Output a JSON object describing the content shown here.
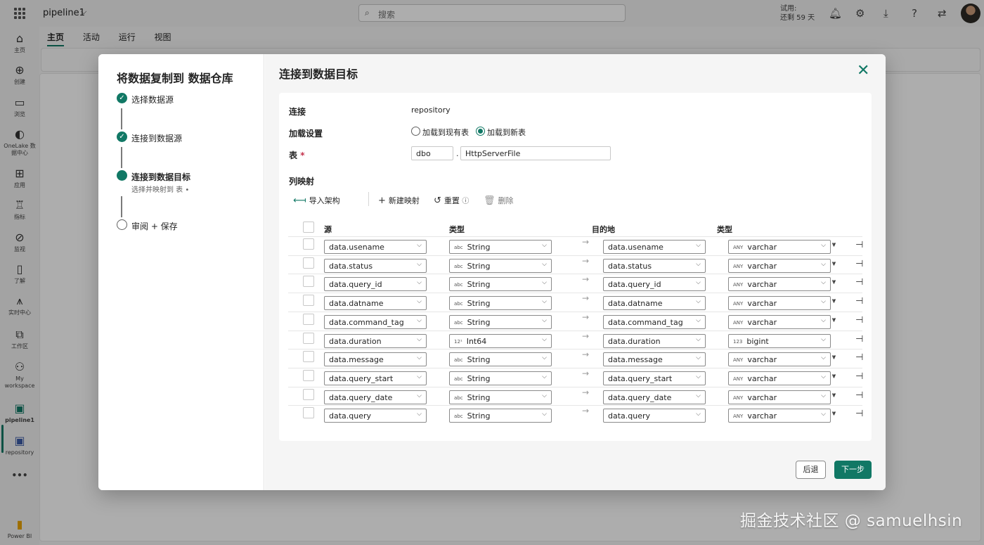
{
  "topbar": {
    "app_title": "pipeline1",
    "search_placeholder": "搜索",
    "trial_line1": "试用:",
    "trial_line2": "还剩 59 天"
  },
  "rail": {
    "items": [
      {
        "label": "主页",
        "icon": "home-icon"
      },
      {
        "label": "创建",
        "icon": "create-icon"
      },
      {
        "label": "浏览",
        "icon": "folder-icon"
      },
      {
        "label": "OneLake 数据中心",
        "icon": "onelake-icon"
      },
      {
        "label": "应用",
        "icon": "apps-icon"
      },
      {
        "label": "指标",
        "icon": "trophy-icon"
      },
      {
        "label": "监视",
        "icon": "monitor-icon"
      },
      {
        "label": "了解",
        "icon": "book-icon"
      },
      {
        "label": "实时中心",
        "icon": "realtime-icon"
      },
      {
        "label": "工作区",
        "icon": "workspace-icon"
      },
      {
        "label": "My workspace",
        "icon": "my-workspace-icon"
      },
      {
        "label": "pipeline1",
        "icon": "pipeline-icon"
      },
      {
        "label": "repository",
        "icon": "repository-icon"
      }
    ],
    "more": "•••",
    "powerbi": "Power BI"
  },
  "ribbon": {
    "tabs": [
      "主页",
      "活动",
      "运行",
      "视图"
    ]
  },
  "wizard": {
    "title": "将数据复制到 数据仓库",
    "steps": [
      {
        "label": "选择数据源",
        "state": "done"
      },
      {
        "label": "连接到数据源",
        "state": "done"
      },
      {
        "label": "连接到数据目标",
        "state": "current",
        "sub": "选择并映射到 表 •"
      },
      {
        "label": "审阅 + 保存",
        "state": "todo"
      }
    ]
  },
  "dest": {
    "title": "连接到数据目标",
    "connection_label": "连接",
    "connection_value": "repository",
    "load_label": "加载设置",
    "load_existing": "加载到现有表",
    "load_new": "加载到新表",
    "table_label": "表",
    "table_required": "*",
    "schema_value": "dbo",
    "dot": ".",
    "table_value": "HttpServerFile",
    "mapping_title": "列映射",
    "import_schema": "导入架构",
    "new_mapping": "新建映射",
    "reset": "重置",
    "delete": "删除",
    "col_source": "源",
    "col_type": "类型",
    "col_dest": "目的地",
    "col_dest_type": "类型",
    "rows": [
      {
        "src": "data.usename",
        "src_type_tag": "abc",
        "src_type": "String",
        "dst": "data.usename",
        "dst_type_tag": "ANY",
        "dst_type": "varchar",
        "expandable": true
      },
      {
        "src": "data.status",
        "src_type_tag": "abc",
        "src_type": "String",
        "dst": "data.status",
        "dst_type_tag": "ANY",
        "dst_type": "varchar",
        "expandable": true
      },
      {
        "src": "data.query_id",
        "src_type_tag": "abc",
        "src_type": "String",
        "dst": "data.query_id",
        "dst_type_tag": "ANY",
        "dst_type": "varchar",
        "expandable": true
      },
      {
        "src": "data.datname",
        "src_type_tag": "abc",
        "src_type": "String",
        "dst": "data.datname",
        "dst_type_tag": "ANY",
        "dst_type": "varchar",
        "expandable": true
      },
      {
        "src": "data.command_tag",
        "src_type_tag": "abc",
        "src_type": "String",
        "dst": "data.command_tag",
        "dst_type_tag": "ANY",
        "dst_type": "varchar",
        "expandable": true
      },
      {
        "src": "data.duration",
        "src_type_tag": "12¹",
        "src_type": "Int64",
        "dst": "data.duration",
        "dst_type_tag": "123",
        "dst_type": "bigint",
        "expandable": false
      },
      {
        "src": "data.message",
        "src_type_tag": "abc",
        "src_type": "String",
        "dst": "data.message",
        "dst_type_tag": "ANY",
        "dst_type": "varchar",
        "expandable": true
      },
      {
        "src": "data.query_start",
        "src_type_tag": "abc",
        "src_type": "String",
        "dst": "data.query_start",
        "dst_type_tag": "ANY",
        "dst_type": "varchar",
        "expandable": true
      },
      {
        "src": "data.query_date",
        "src_type_tag": "abc",
        "src_type": "String",
        "dst": "data.query_date",
        "dst_type_tag": "ANY",
        "dst_type": "varchar",
        "expandable": true
      },
      {
        "src": "data.query",
        "src_type_tag": "abc",
        "src_type": "String",
        "dst": "data.query",
        "dst_type_tag": "ANY",
        "dst_type": "varchar",
        "expandable": true
      }
    ]
  },
  "footer": {
    "back": "后退",
    "next": "下一步"
  },
  "watermark": "掘金技术社区 @ samuelhsin",
  "colors": {
    "accent": "#117865"
  }
}
